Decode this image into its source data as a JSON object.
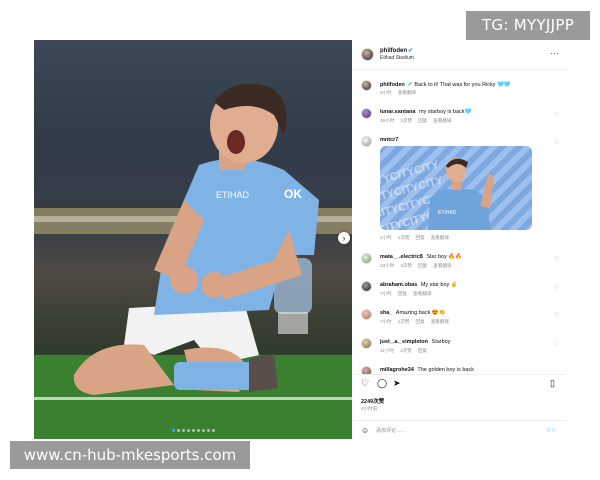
{
  "watermarks": {
    "top": "TG: MYYJJPP",
    "bottom": "www.cn-hub-mkesports.com"
  },
  "post": {
    "username": "philfoden",
    "location": "Etihad Stadium",
    "more_icon": "more-horizontal-icon"
  },
  "comments": [
    {
      "user": "philfoden",
      "text": "Back to it! That was for you Ricky 🩵🩵",
      "meta": [
        "4小时",
        "查看翻译"
      ],
      "verified": true
    },
    {
      "user": "lunar.santana",
      "text": "my starboy is back🩵",
      "meta": [
        "19小时",
        "2次赞",
        "回复",
        "查看翻译"
      ]
    },
    {
      "user": "mntcr7",
      "text": "",
      "meta": [
        "4小时",
        "1次赞",
        "回复",
        "查看翻译"
      ],
      "sticker_text": "CITYCITYCITY"
    },
    {
      "user": "mata__.electric8",
      "text": "Star boy 🔥🔥",
      "meta": [
        "23小时",
        "3次赞",
        "回复",
        "查看翻译"
      ]
    },
    {
      "user": "abraham.obas",
      "text": "My star boy ✌️",
      "meta": [
        "7小时",
        "回复",
        "查看翻译"
      ]
    },
    {
      "user": "sha_",
      "text": "Amazing back 😍👏",
      "meta": [
        "7小时",
        "1次赞",
        "回复",
        "查看翻译"
      ]
    },
    {
      "user": "just_.a._simpleton",
      "text": "Starboy",
      "meta": [
        "11小时",
        "1次赞",
        "回复"
      ]
    },
    {
      "user": "millagrohe34",
      "text": "The golden boy is back",
      "meta": []
    }
  ],
  "actions": {
    "like_icon": "heart-icon",
    "comment_icon": "comment-icon",
    "share_icon": "send-icon",
    "save_icon": "bookmark-icon"
  },
  "likes": "2249次赞",
  "time_ago": "4小时前",
  "comment_box": {
    "placeholder": "添加评论……",
    "post_label": "发布"
  },
  "colors": {
    "verified": "#3897f0",
    "kit_blue": "#7fb2e5",
    "pitch_green": "#3a7d30"
  }
}
